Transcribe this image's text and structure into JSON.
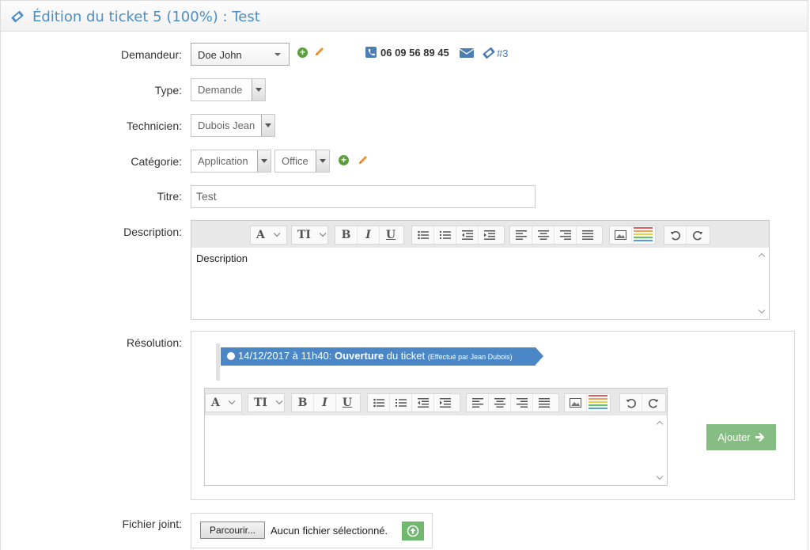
{
  "header": {
    "title": "Édition du ticket 5 (100%) : Test"
  },
  "form": {
    "labels": {
      "demandeur": "Demandeur:",
      "type": "Type:",
      "technicien": "Technicien:",
      "categorie": "Catégorie:",
      "titre": "Titre:",
      "description": "Description:",
      "resolution": "Résolution:",
      "fichier": "Fichier joint:"
    },
    "demandeur": {
      "value": "Doe John",
      "phone": "06 09 56 89 45",
      "ticket_link": "#3"
    },
    "type": {
      "value": "Demande"
    },
    "technicien": {
      "value": "Dubois Jean"
    },
    "categorie": {
      "value": "Application",
      "subcategory": "Office"
    },
    "titre": {
      "value": "Test"
    },
    "description": {
      "content": "Description"
    }
  },
  "resolution": {
    "event": {
      "datetime": "14/12/2017 à 11h40:",
      "action": "Ouverture",
      "text": "du ticket",
      "by": "(Effectué par Jean Dubois)"
    },
    "add_label": "Ajouter"
  },
  "file": {
    "browse_label": "Parcourir...",
    "status": "Aucun fichier sélectionné."
  },
  "toolbar": {
    "font_label": "A",
    "size_label": "TI",
    "bold": "B",
    "italic": "I",
    "underline": "U"
  },
  "colors": {
    "accent": "#4b87c6",
    "success": "#86bd82",
    "add_icon": "#5a9e3e",
    "edit_icon": "#f0902a"
  },
  "icons": [
    "ticket-icon",
    "plus-circle-icon",
    "pencil-icon",
    "phone-icon",
    "mail-icon",
    "list-bullet-icon",
    "list-numbered-icon",
    "outdent-icon",
    "indent-icon",
    "align-left-icon",
    "align-center-icon",
    "align-right-icon",
    "align-justify-icon",
    "image-icon",
    "color-palette-icon",
    "undo-icon",
    "redo-icon",
    "arrow-right-icon",
    "upload-icon"
  ]
}
